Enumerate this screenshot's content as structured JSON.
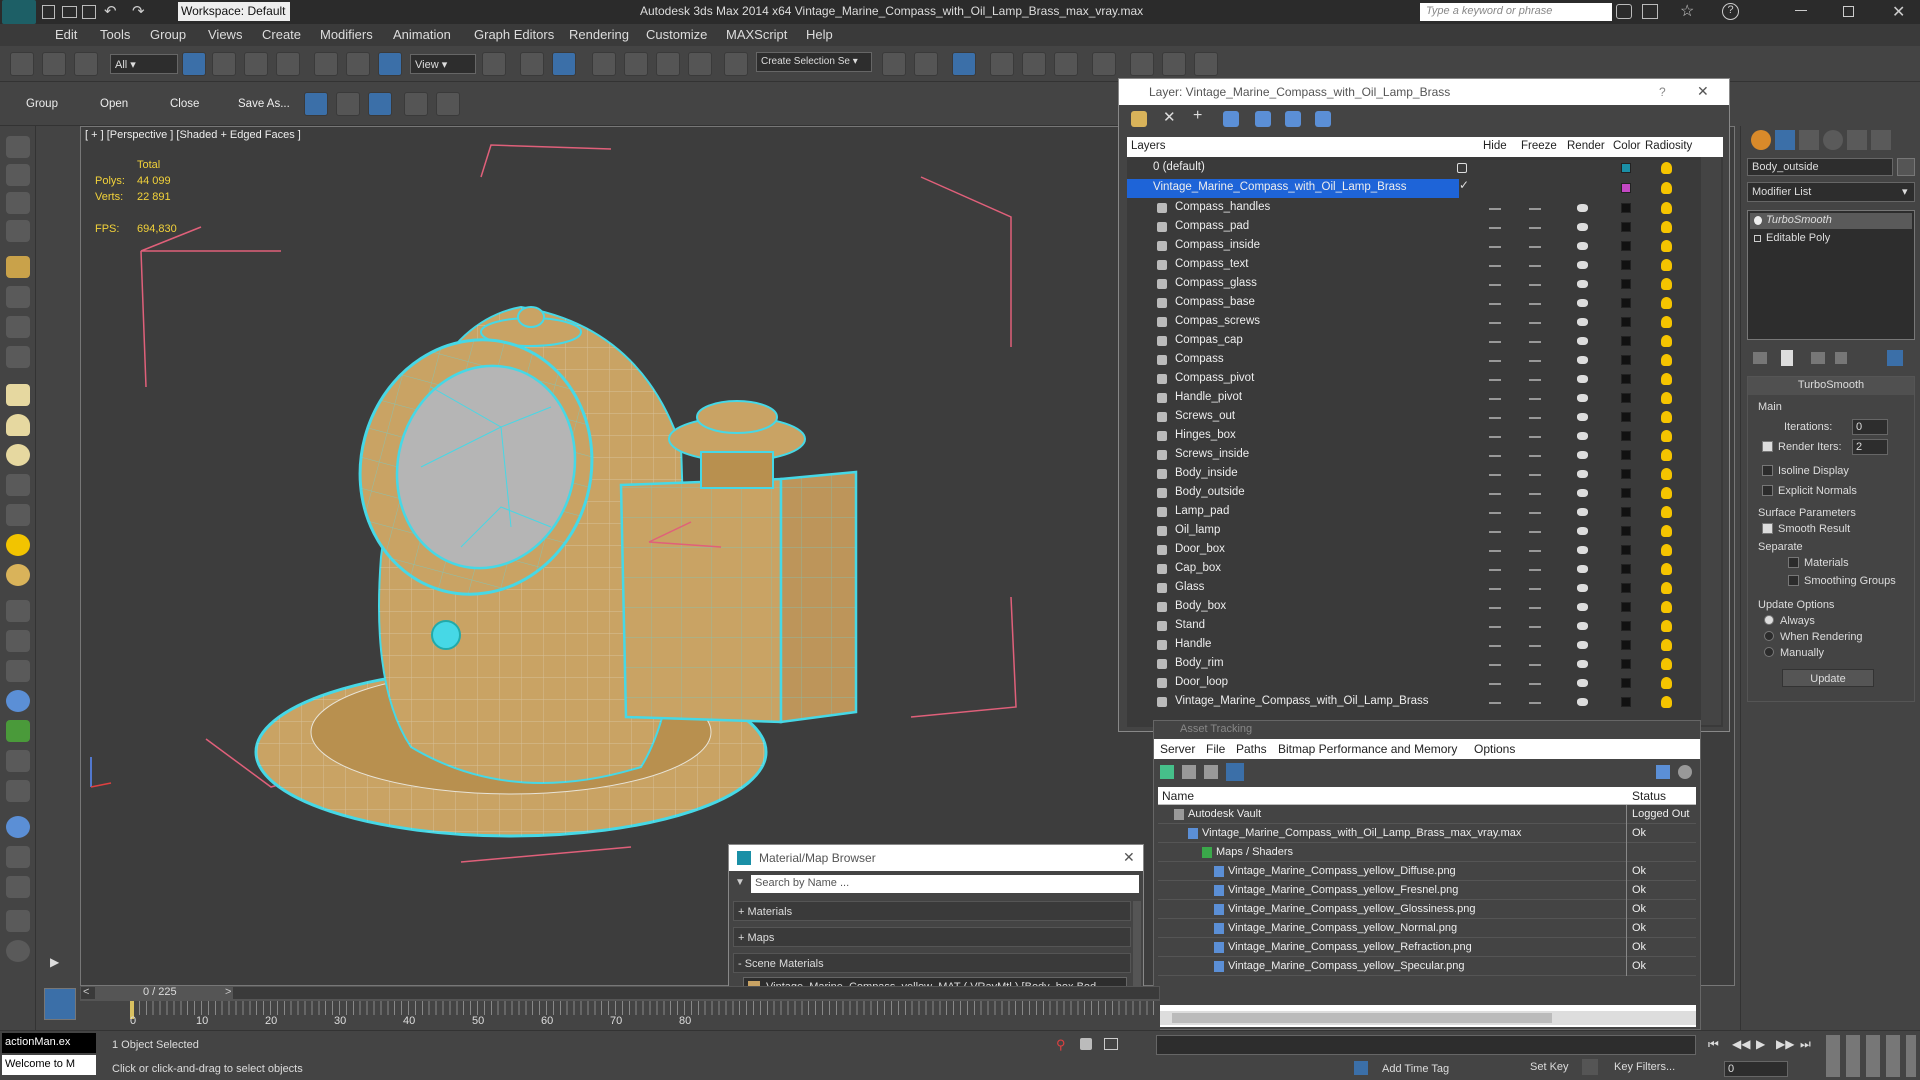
{
  "titlebar": {
    "workspace": "Workspace: Default",
    "title": "Autodesk 3ds Max  2014 x64     Vintage_Marine_Compass_with_Oil_Lamp_Brass_max_vray.max",
    "search_placeholder": "Type a keyword or phrase"
  },
  "menu": [
    "Edit",
    "Tools",
    "Group",
    "Views",
    "Create",
    "Modifiers",
    "Animation",
    "Graph Editors",
    "Rendering",
    "Customize",
    "MAXScript",
    "Help"
  ],
  "toolbar": {
    "filter": "All",
    "refcoord": "View",
    "selection_set": "Create Selection Se"
  },
  "toolbar2": {
    "group": "Group",
    "open": "Open",
    "close": "Close",
    "save_as": "Save As..."
  },
  "viewport": {
    "label": "[ + ] [Perspective ] [Shaded + Edged Faces ]",
    "stats_total": "Total",
    "polys_label": "Polys:",
    "polys_value": "44 099",
    "verts_label": "Verts:",
    "verts_value": "22 891",
    "fps_label": "FPS:",
    "fps_value": "694,830"
  },
  "layer_dialog": {
    "title": "Layer: Vintage_Marine_Compass_with_Oil_Lamp_Brass",
    "columns": {
      "layers": "Layers",
      "hide": "Hide",
      "freeze": "Freeze",
      "render": "Render",
      "color": "Color",
      "radiosity": "Radiosity"
    },
    "default_layer": "0 (default)",
    "main_layer": "Vintage_Marine_Compass_with_Oil_Lamp_Brass",
    "objects": [
      "Compass_handles",
      "Compass_pad",
      "Compass_inside",
      "Compass_text",
      "Compass_glass",
      "Compass_base",
      "Compas_screws",
      "Compas_cap",
      "Compass",
      "Compass_pivot",
      "Handle_pivot",
      "Screws_out",
      "Hinges_box",
      "Screws_inside",
      "Body_inside",
      "Body_outside",
      "Lamp_pad",
      "Oil_lamp",
      "Door_box",
      "Cap_box",
      "Glass",
      "Body_box",
      "Stand",
      "Handle",
      "Body_rim",
      "Door_loop",
      "Vintage_Marine_Compass_with_Oil_Lamp_Brass"
    ]
  },
  "asset_tracking": {
    "title": "Asset Tracking",
    "menu": [
      "Server",
      "File",
      "Paths",
      "Bitmap Performance and Memory",
      "Options"
    ],
    "col_name": "Name",
    "col_status": "Status",
    "rows": [
      {
        "name": "Autodesk Vault",
        "status": "Logged Out"
      },
      {
        "name": "Vintage_Marine_Compass_with_Oil_Lamp_Brass_max_vray.max",
        "status": "Ok"
      },
      {
        "name": "Maps / Shaders",
        "status": ""
      },
      {
        "name": "Vintage_Marine_Compass_yellow_Diffuse.png",
        "status": "Ok"
      },
      {
        "name": "Vintage_Marine_Compass_yellow_Fresnel.png",
        "status": "Ok"
      },
      {
        "name": "Vintage_Marine_Compass_yellow_Glossiness.png",
        "status": "Ok"
      },
      {
        "name": "Vintage_Marine_Compass_yellow_Normal.png",
        "status": "Ok"
      },
      {
        "name": "Vintage_Marine_Compass_yellow_Refraction.png",
        "status": "Ok"
      },
      {
        "name": "Vintage_Marine_Compass_yellow_Specular.png",
        "status": "Ok"
      }
    ]
  },
  "material_browser": {
    "title": "Material/Map Browser",
    "search_placeholder": "Search by Name ...",
    "sections": [
      "+ Materials",
      "+ Maps",
      "- Scene Materials"
    ],
    "scene_material": "Vintage_Marine_Compass_yellow_MAT ( VRayMtl ) [Body_box,Bod..."
  },
  "command_panel": {
    "object_name": "Body_outside",
    "modifier_list": "Modifier List",
    "stack": [
      "TurboSmooth",
      "Editable Poly"
    ],
    "rollout_title": "TurboSmooth",
    "main_label": "Main",
    "iterations_label": "Iterations:",
    "iterations_value": "0",
    "render_iters_label": "Render Iters:",
    "render_iters_value": "2",
    "isoline": "Isoline Display",
    "explicit": "Explicit Normals",
    "surface_params": "Surface Parameters",
    "smooth_result": "Smooth Result",
    "separate": "Separate",
    "materials": "Materials",
    "smoothing_groups": "Smoothing Groups",
    "update_options": "Update Options",
    "always": "Always",
    "when_rendering": "When Rendering",
    "manually": "Manually",
    "update_btn": "Update"
  },
  "timeline": {
    "frame_counter": "0 / 225",
    "ticks": [
      "0",
      "10",
      "20",
      "30",
      "40",
      "50",
      "60",
      "70",
      "80"
    ]
  },
  "status": {
    "script_listener_1": "actionMan.ex",
    "script_listener_2": "Welcome to M",
    "selected": "1 Object Selected",
    "prompt": "Click or click-and-drag to select objects",
    "add_time_tag": "Add Time Tag",
    "set_key": "Set Key",
    "key_filters": "Key Filters...",
    "frame_value": "0"
  },
  "colors": {
    "wire": "#46d8e6",
    "brass": "#c9a364",
    "bbox": "#e0607a",
    "selection": "#1e64d8"
  }
}
